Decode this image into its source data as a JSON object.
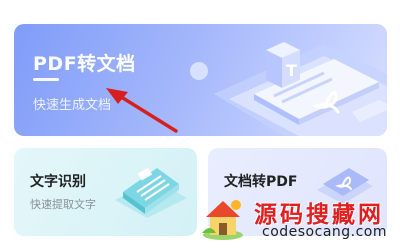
{
  "main_card": {
    "title": "PDF转文档",
    "subtitle": "快速生成文档",
    "doc_glyph": "T"
  },
  "cards": [
    {
      "title": "文字识别",
      "subtitle": "快速提取文字"
    },
    {
      "title": "文档转PDF"
    }
  ],
  "watermark": {
    "text": "源码搜藏网",
    "url": "codesocang.com"
  },
  "colors": {
    "main_card_gradient": [
      "#7f9cf8",
      "#d8e0ff"
    ],
    "arrow": "#d62020",
    "watermark_red": "#e02020"
  },
  "icons": [
    "pdf-document-illustration",
    "text-recognition-illustration",
    "doc-to-pdf-illustration",
    "watermark-house-logo"
  ]
}
